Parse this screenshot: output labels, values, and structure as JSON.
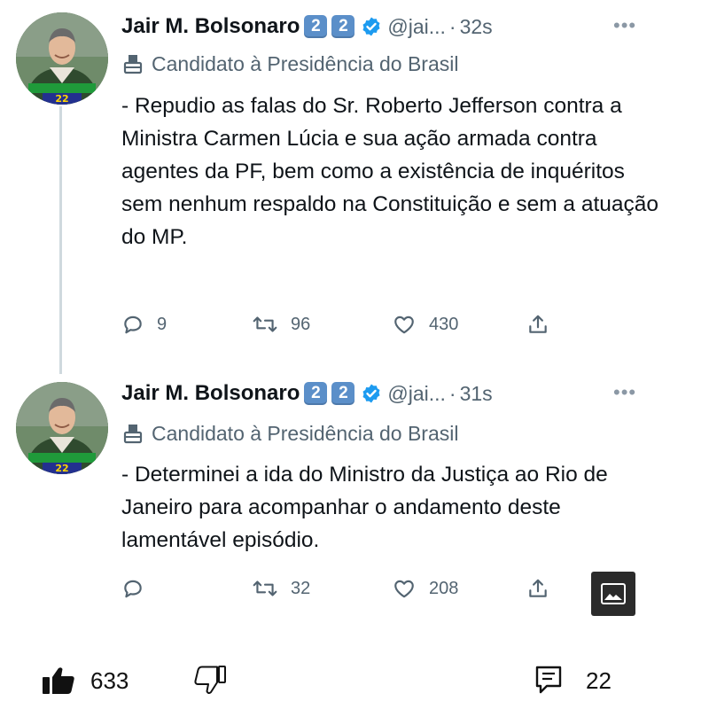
{
  "tweets": [
    {
      "author_name": "Jair M. Bolsonaro",
      "badges": [
        "2",
        "2"
      ],
      "handle": "@jai...",
      "time": "32s",
      "label": "Candidato à Presidência do Brasil",
      "text": "- Repudio as falas do Sr. Roberto Jefferson contra a Ministra Carmen Lúcia e sua ação armada contra agentes da PF, bem como a existência de inquéritos sem nenhum respaldo na Constituição e sem a atuação do MP.",
      "replies": "9",
      "retweets": "96",
      "likes": "430"
    },
    {
      "author_name": "Jair M. Bolsonaro",
      "badges": [
        "2",
        "2"
      ],
      "handle": "@jai...",
      "time": "31s",
      "label": "Candidato à Presidência do Brasil",
      "text": "- Determinei a ida do Ministro da Justiça ao Rio de Janeiro para acompanhar o andamento deste lamentável episódio.",
      "replies": "",
      "retweets": "32",
      "likes": "208"
    }
  ],
  "avatar_caption": "22",
  "post_bar": {
    "likes": "633",
    "comments": "22"
  },
  "icons": {
    "verified": "verified-badge-icon",
    "label": "ballot-box-icon",
    "reply": "reply-icon",
    "retweet": "retweet-icon",
    "like": "heart-icon",
    "share": "share-icon",
    "image": "image-icon",
    "thumbs_up": "thumbs-up-icon",
    "thumbs_down": "thumbs-down-icon",
    "comments": "comment-icon"
  },
  "colors": {
    "verified": "#1d9bf0",
    "emoji_box": "#5b8fc9",
    "secondary_text": "#536471"
  }
}
